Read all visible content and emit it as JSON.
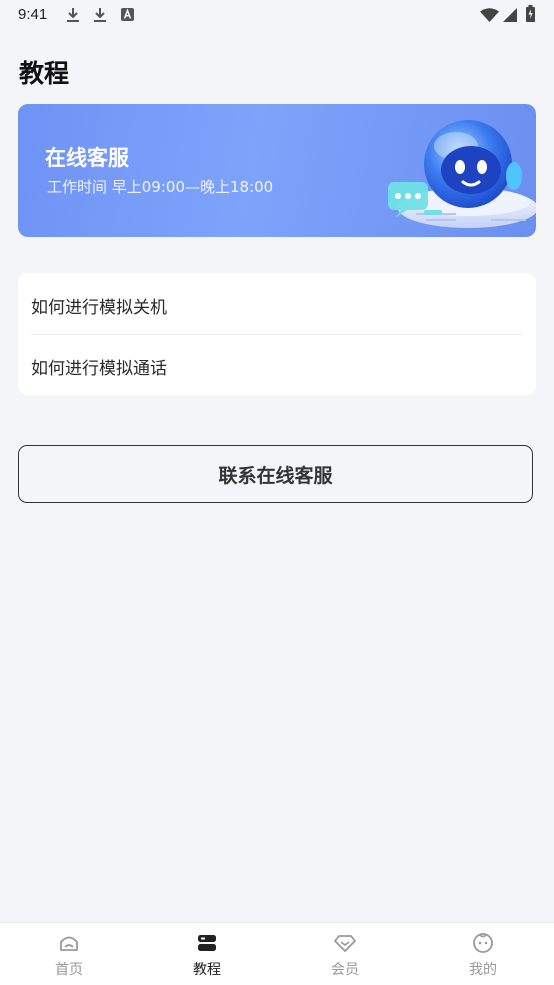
{
  "status_bar": {
    "time": "9:41"
  },
  "page": {
    "title": "教程"
  },
  "banner": {
    "title": "在线客服",
    "subtitle": "工作时间 早上09:00—晚上18:00"
  },
  "tutorials": [
    {
      "label": "如何进行模拟关机"
    },
    {
      "label": "如何进行模拟通话"
    }
  ],
  "contact_button": {
    "label": "联系在线客服"
  },
  "tabbar": {
    "active": "教程",
    "tabs": [
      {
        "label": "首页",
        "icon": "home-icon"
      },
      {
        "label": "教程",
        "icon": "tutorial-icon"
      },
      {
        "label": "会员",
        "icon": "diamond-icon"
      },
      {
        "label": "我的",
        "icon": "smiley-icon"
      }
    ]
  },
  "colors": {
    "banner": "#7ea3fb",
    "background": "#f4f5f9",
    "active_tab": "#222222",
    "inactive_tab": "#999999"
  }
}
